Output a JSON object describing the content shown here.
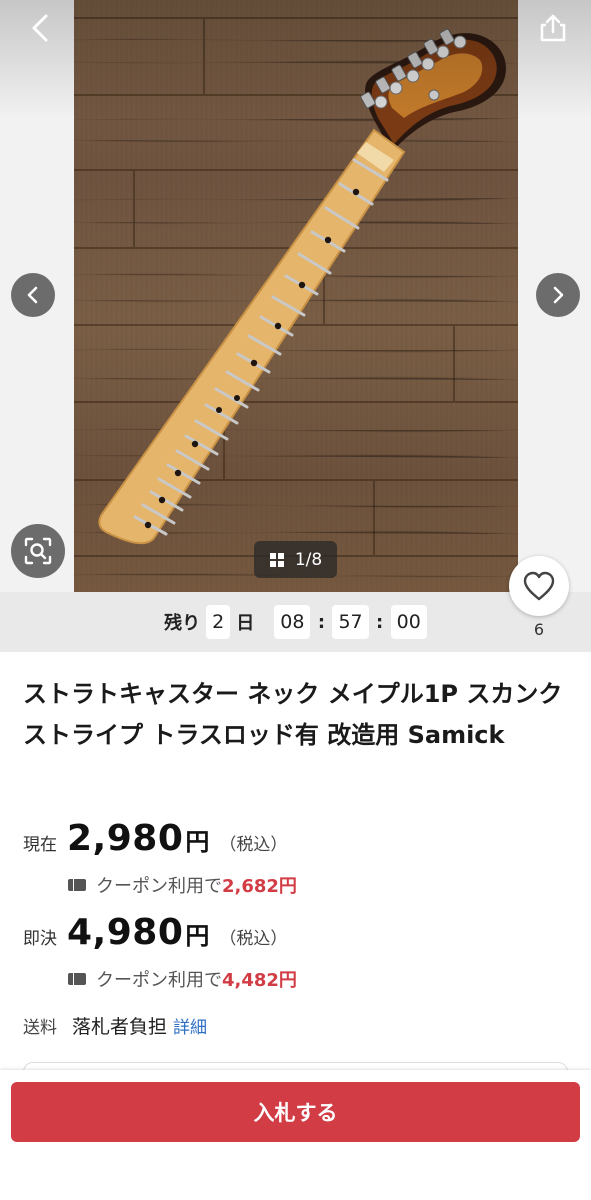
{
  "product": {
    "title": "ストラトキャスター ネック メイプル1P スカンクストライプ トラスロッド有 改造用 Samick"
  },
  "gallery": {
    "counter": "1/8"
  },
  "countdown": {
    "prefix": "残り",
    "days": "2",
    "days_unit": "日",
    "hours": "08",
    "minutes": "57",
    "seconds": "00",
    "separator": ":"
  },
  "favorite": {
    "count": "6"
  },
  "prices": {
    "current": {
      "label": "現在",
      "amount": "2,980",
      "currency": "円",
      "tax": "（税込）",
      "coupon_text": "クーポン利用で",
      "coupon_amount": "2,682円"
    },
    "buyout": {
      "label": "即決",
      "amount": "4,980",
      "currency": "円",
      "tax": "（税込）",
      "coupon_text": "クーポン利用で",
      "coupon_amount": "4,482円"
    }
  },
  "shipping": {
    "label": "送料",
    "value": "落札者負担",
    "link": "詳細"
  },
  "actions": {
    "bid_label": "入札する"
  },
  "colors": {
    "accent_red": "#d13c45",
    "link_blue": "#2f6fc4"
  }
}
